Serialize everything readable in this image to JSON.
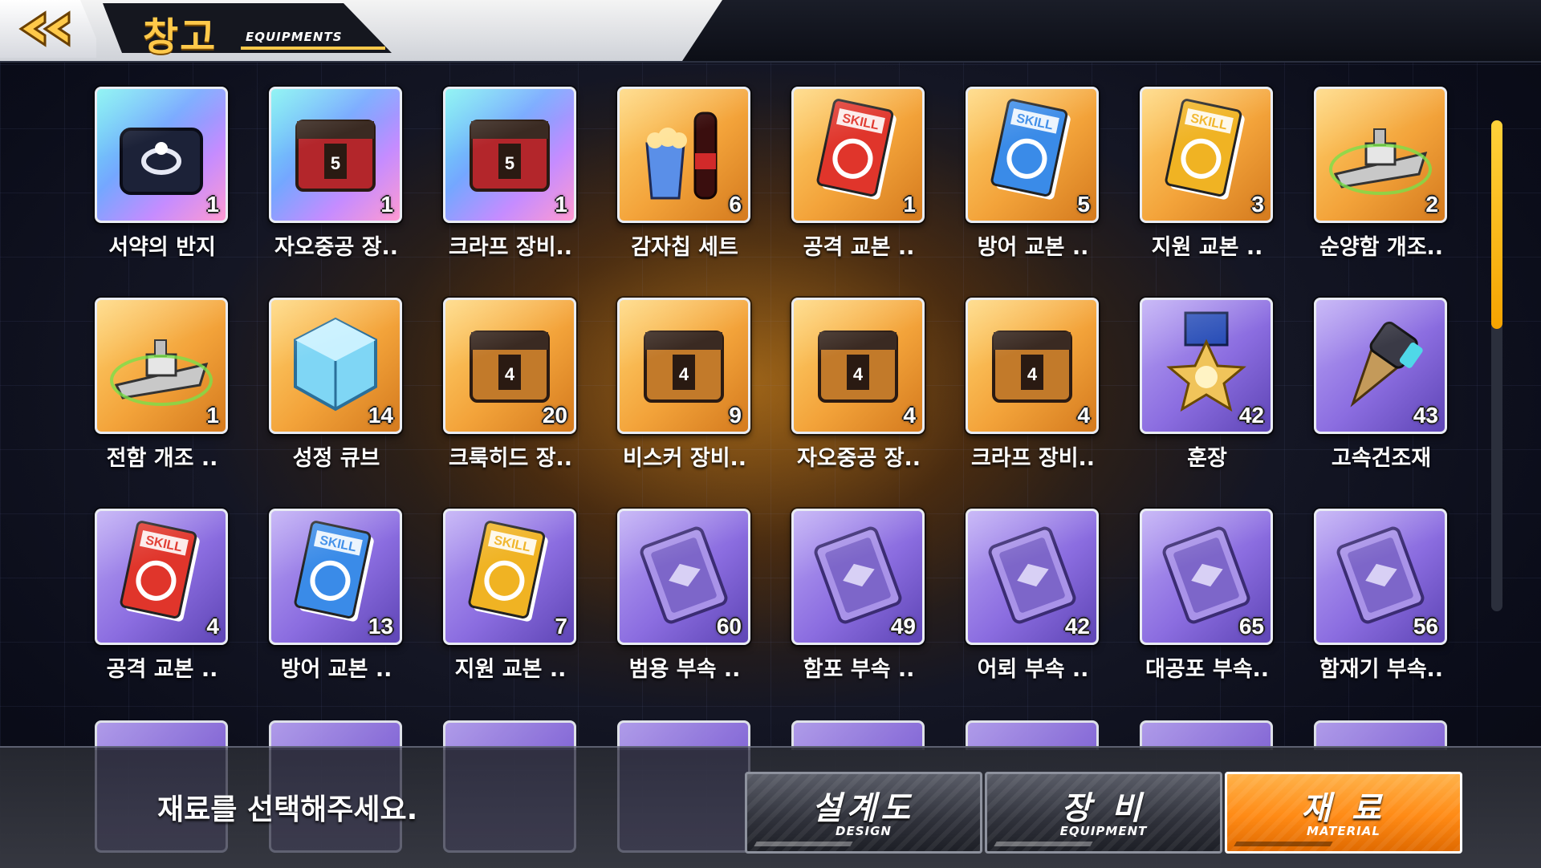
{
  "header": {
    "title": "창고",
    "subtitle": "EQUIPMENTS",
    "back_icon": "double-chevron-left-icon"
  },
  "colors": {
    "accent": "#ffc94a",
    "active_tab": "#ff8a15",
    "gold_tile": "#f3a33a",
    "purple_tile": "#8b6de0"
  },
  "items": [
    {
      "name": "서약의 반지",
      "count": "1",
      "icon": "ring-box-icon",
      "rarity": "rainbow"
    },
    {
      "name": "자오중공 장..",
      "count": "1",
      "icon": "tech5-crate-icon",
      "rarity": "rainbow"
    },
    {
      "name": "크라프 장비..",
      "count": "1",
      "icon": "tech5-crate-icon",
      "rarity": "rainbow"
    },
    {
      "name": "감자칩 세트",
      "count": "6",
      "icon": "popcorn-cola-icon",
      "rarity": "gold"
    },
    {
      "name": "공격 교본 ..",
      "count": "1",
      "icon": "skill-book-red-icon",
      "rarity": "gold"
    },
    {
      "name": "방어 교본 ..",
      "count": "5",
      "icon": "skill-book-blue-icon",
      "rarity": "gold"
    },
    {
      "name": "지원 교본 ..",
      "count": "3",
      "icon": "skill-book-yellow-icon",
      "rarity": "gold"
    },
    {
      "name": "순양함 개조..",
      "count": "2",
      "icon": "cruiser-retrofit-icon",
      "rarity": "gold"
    },
    {
      "name": "전함 개조 ..",
      "count": "1",
      "icon": "battleship-retrofit-icon",
      "rarity": "gold"
    },
    {
      "name": "성정 큐브",
      "count": "14",
      "icon": "wisdom-cube-icon",
      "rarity": "gold"
    },
    {
      "name": "크룩히드 장..",
      "count": "20",
      "icon": "tech4-crate-icon",
      "rarity": "gold"
    },
    {
      "name": "비스커 장비..",
      "count": "9",
      "icon": "tech4-crate-icon",
      "rarity": "gold"
    },
    {
      "name": "자오중공 장..",
      "count": "4",
      "icon": "tech4-crate-icon",
      "rarity": "gold"
    },
    {
      "name": "크라프 장비..",
      "count": "4",
      "icon": "tech4-crate-icon",
      "rarity": "gold"
    },
    {
      "name": "훈장",
      "count": "42",
      "icon": "medal-icon",
      "rarity": "purple"
    },
    {
      "name": "고속건조재",
      "count": "43",
      "icon": "drill-icon",
      "rarity": "purple"
    },
    {
      "name": "공격 교본 ..",
      "count": "4",
      "icon": "skill-book-red-icon",
      "rarity": "purple"
    },
    {
      "name": "방어 교본 ..",
      "count": "13",
      "icon": "skill-book-blue-icon",
      "rarity": "purple"
    },
    {
      "name": "지원 교본 ..",
      "count": "7",
      "icon": "skill-book-yellow-icon",
      "rarity": "purple"
    },
    {
      "name": "범용 부속 ..",
      "count": "60",
      "icon": "general-parts-icon",
      "rarity": "purple"
    },
    {
      "name": "함포 부속 ..",
      "count": "49",
      "icon": "gun-parts-icon",
      "rarity": "purple"
    },
    {
      "name": "어뢰 부속 ..",
      "count": "42",
      "icon": "torpedo-parts-icon",
      "rarity": "purple"
    },
    {
      "name": "대공포 부속..",
      "count": "65",
      "icon": "aa-gun-parts-icon",
      "rarity": "purple"
    },
    {
      "name": "함재기 부속..",
      "count": "56",
      "icon": "aircraft-parts-icon",
      "rarity": "purple"
    }
  ],
  "footer": {
    "prompt": "재료를 선택해주세요.",
    "tabs": [
      {
        "ko": "설계도",
        "en": "DESIGN",
        "active": false
      },
      {
        "ko": "장 비",
        "en": "EQUIPMENT",
        "active": false
      },
      {
        "ko": "재 료",
        "en": "MATERIAL",
        "active": true
      }
    ]
  }
}
